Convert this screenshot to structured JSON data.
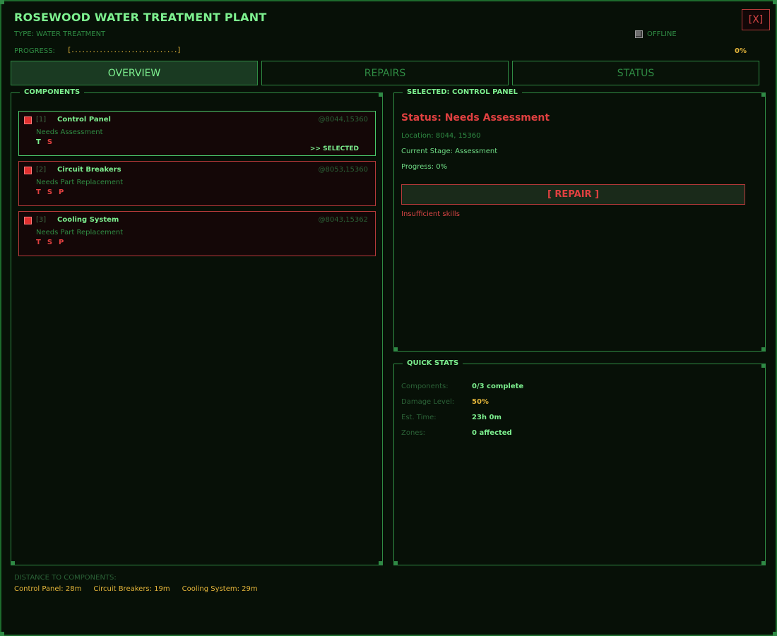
{
  "header": {
    "title": "ROSEWOOD WATER TREATMENT PLANT",
    "type": "TYPE: WATER TREATMENT",
    "status": "OFFLINE",
    "close_label": "[X]",
    "progress_label": "PROGRESS:",
    "progress_bar": "[..............................]",
    "progress_pct": "0%",
    "progress_value": 0
  },
  "tabs": [
    {
      "label": "OVERVIEW",
      "active": true
    },
    {
      "label": "REPAIRS",
      "active": false
    },
    {
      "label": "STATUS",
      "active": false
    }
  ],
  "components_panel": {
    "title": "COMPONENTS",
    "items": [
      {
        "index": "[1]",
        "name": "Control Panel",
        "coord": "@8044,15360",
        "need": "Needs Assessment",
        "skills": [
          "T",
          "S"
        ],
        "skill_state": [
          "ok",
          "bad"
        ],
        "selected": true,
        "selected_label": ">> SELECTED"
      },
      {
        "index": "[2]",
        "name": "Circuit Breakers",
        "coord": "@8053,15360",
        "need": "Needs Part Replacement",
        "skills": [
          "T",
          "S",
          "P"
        ],
        "skill_state": [
          "bad",
          "bad",
          "bad"
        ],
        "selected": false
      },
      {
        "index": "[3]",
        "name": "Cooling System",
        "coord": "@8043,15362",
        "need": "Needs Part Replacement",
        "skills": [
          "T",
          "S",
          "P"
        ],
        "skill_state": [
          "bad",
          "bad",
          "bad"
        ],
        "selected": false
      }
    ]
  },
  "detail_panel": {
    "title": "SELECTED: CONTROL PANEL",
    "status": "Status: Needs Assessment",
    "location": "Location: 8044, 15360",
    "stage": "Current Stage: Assessment",
    "progress": "Progress: 0%",
    "repair_label": "[ REPAIR ]",
    "warning": "Insufficient skills"
  },
  "quick_stats": {
    "title": "QUICK STATS",
    "rows": [
      {
        "label": "Components:",
        "value": "0/3 complete",
        "color": "#7df08f"
      },
      {
        "label": "Damage Level:",
        "value": "50%",
        "color": "#e3b53a"
      },
      {
        "label": "Est. Time:",
        "value": "23h 0m",
        "color": "#7df08f"
      },
      {
        "label": "Zones:",
        "value": "0 affected",
        "color": "#7df08f"
      }
    ]
  },
  "distances": {
    "title": "DISTANCE TO COMPONENTS:",
    "items": [
      "Control Panel: 28m",
      "Circuit Breakers: 19m",
      "Cooling System: 29m"
    ]
  },
  "colors": {
    "accent_green": "#7df08f",
    "dim_green": "#2f8b43",
    "alert_red": "#e04040",
    "amber": "#e3b53a"
  }
}
